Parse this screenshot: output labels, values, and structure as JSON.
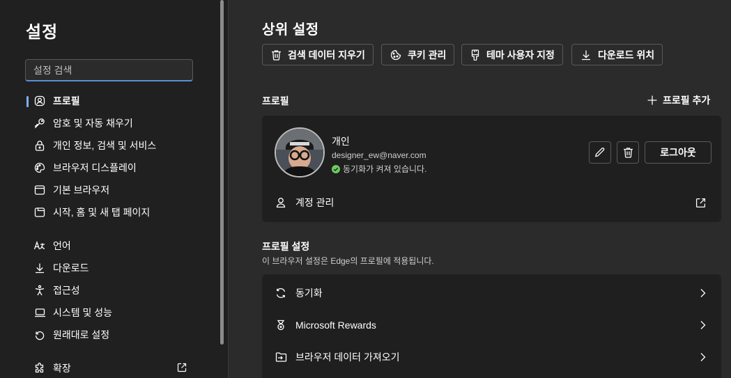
{
  "sidebar": {
    "title": "설정",
    "search_placeholder": "설정 검색",
    "items": [
      {
        "label": "프로필",
        "icon": "profile-icon",
        "active": true
      },
      {
        "label": "암호 및 자동 채우기",
        "icon": "key-icon"
      },
      {
        "label": "개인 정보, 검색 및 서비스",
        "icon": "lock-icon"
      },
      {
        "label": "브라우저 디스플레이",
        "icon": "palette-icon"
      },
      {
        "label": "기본 브라우저",
        "icon": "browser-icon"
      },
      {
        "label": "시작, 홈 및 새 탭 페이지",
        "icon": "new-tab-icon"
      },
      {
        "label": "언어",
        "icon": "language-icon"
      },
      {
        "label": "다운로드",
        "icon": "download-icon"
      },
      {
        "label": "접근성",
        "icon": "accessibility-icon"
      },
      {
        "label": "시스템 및 성능",
        "icon": "laptop-icon"
      },
      {
        "label": "원래대로 설정",
        "icon": "reset-icon"
      },
      {
        "label": "확장",
        "icon": "extension-icon"
      }
    ]
  },
  "main": {
    "title": "상위 설정",
    "top_buttons": [
      {
        "label": "검색 데이터 지우기",
        "icon": "trash-icon"
      },
      {
        "label": "쿠키 관리",
        "icon": "cookie-icon"
      },
      {
        "label": "테마 사용자 지정",
        "icon": "brush-icon"
      },
      {
        "label": "다운로드 위치",
        "icon": "download-icon"
      }
    ],
    "profile_section": {
      "label": "프로필",
      "add_label": "프로필 추가",
      "name": "개인",
      "email": "designer_ew@naver.com",
      "sync_status": "동기화가 켜져 있습니다.",
      "logout_label": "로그아웃",
      "manage_account_label": "계정 관리"
    },
    "profile_settings": {
      "label": "프로필 설정",
      "description": "이 브라우저 설정은 Edge의 프로필에 적용됩니다.",
      "rows": [
        {
          "label": "동기화",
          "icon": "sync-icon"
        },
        {
          "label": "Microsoft Rewards",
          "icon": "medal-icon"
        },
        {
          "label": "브라우저 데이터 가져오기",
          "icon": "import-icon"
        }
      ]
    }
  },
  "colors": {
    "sidebar_bg": "#202020",
    "main_bg": "#2b2b2b",
    "card_bg": "#1f1f1f",
    "accent": "#5b8fd6",
    "sync_green": "#6ccb5f"
  }
}
